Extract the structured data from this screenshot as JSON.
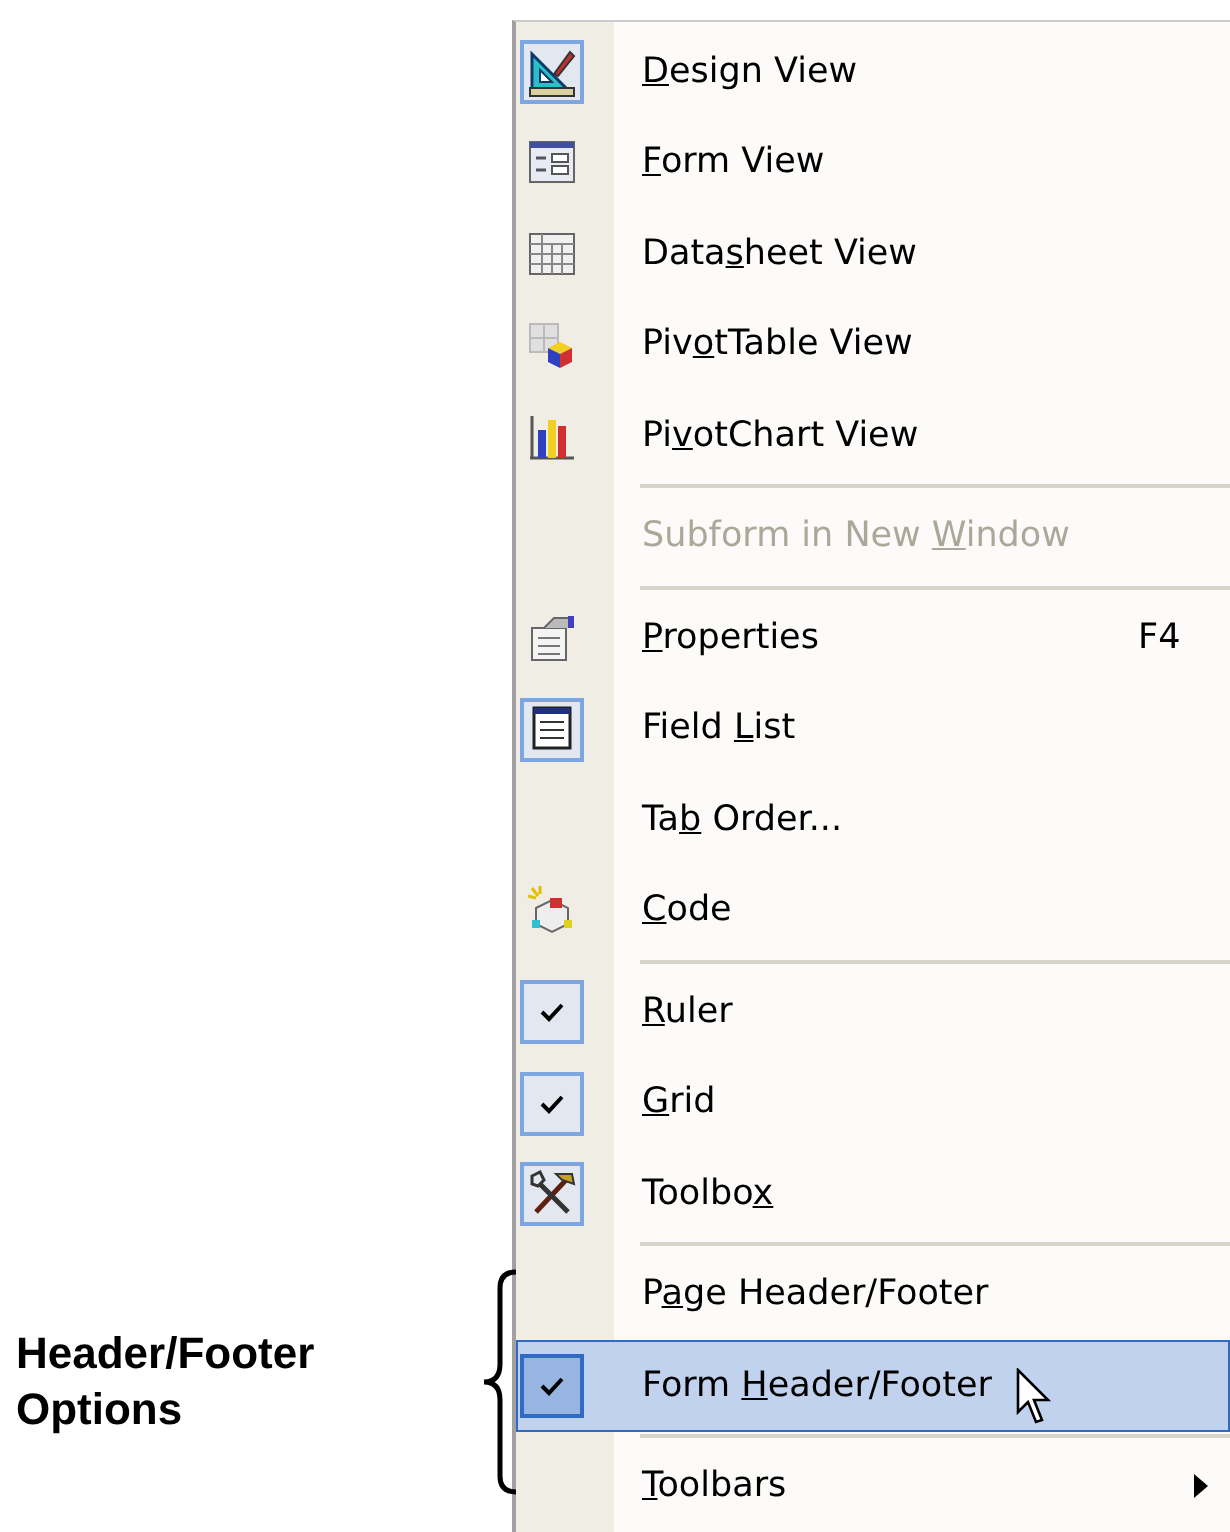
{
  "menu": {
    "items": [
      {
        "kind": "item",
        "key": "D",
        "after": "esign View",
        "checked": true,
        "disabled": false,
        "selected": false
      },
      {
        "kind": "item",
        "key": "F",
        "after": "orm View",
        "checked": false,
        "disabled": false,
        "selected": false
      },
      {
        "kind": "item",
        "before": "Data",
        "key": "s",
        "after": "heet View",
        "checked": false,
        "disabled": false,
        "selected": false
      },
      {
        "kind": "item",
        "before": "Piv",
        "key": "o",
        "after": "tTable View",
        "checked": false,
        "disabled": false,
        "selected": false
      },
      {
        "kind": "item",
        "before": "Pi",
        "key": "v",
        "after": "otChart View",
        "checked": false,
        "disabled": false,
        "selected": false
      },
      {
        "kind": "separator"
      },
      {
        "kind": "item",
        "before": "Subform in New ",
        "key": "W",
        "after": "indow",
        "checked": false,
        "disabled": true,
        "selected": false
      },
      {
        "kind": "separator"
      },
      {
        "kind": "item",
        "key": "P",
        "after": "roperties",
        "shortcut": "F4",
        "checked": false,
        "disabled": false,
        "selected": false
      },
      {
        "kind": "item",
        "before": "Field ",
        "key": "L",
        "after": "ist",
        "checked": true,
        "disabled": false,
        "selected": false
      },
      {
        "kind": "item",
        "before": "Ta",
        "key": "b",
        "after": " Order...",
        "checked": false,
        "disabled": false,
        "selected": false
      },
      {
        "kind": "item",
        "key": "C",
        "after": "ode",
        "checked": false,
        "disabled": false,
        "selected": false
      },
      {
        "kind": "separator"
      },
      {
        "kind": "item",
        "key": "R",
        "after": "uler",
        "checked": true,
        "disabled": false,
        "selected": false
      },
      {
        "kind": "item",
        "key": "G",
        "after": "rid",
        "checked": true,
        "disabled": false,
        "selected": false
      },
      {
        "kind": "item",
        "before": "Toolbo",
        "key": "x",
        "checked": true,
        "disabled": false,
        "selected": false
      },
      {
        "kind": "separator"
      },
      {
        "kind": "item",
        "before": "P",
        "key": "a",
        "after": "ge Header/Footer",
        "checked": false,
        "disabled": false,
        "selected": false
      },
      {
        "kind": "item",
        "before": "Form ",
        "key": "H",
        "after": "eader/Footer",
        "checked": true,
        "disabled": false,
        "selected": true
      },
      {
        "kind": "separator"
      },
      {
        "kind": "item",
        "key": "T",
        "after": "oolbars",
        "submenu": true,
        "checked": false,
        "disabled": false,
        "selected": false
      }
    ]
  },
  "callout": {
    "text": "Header/Footer Options"
  }
}
